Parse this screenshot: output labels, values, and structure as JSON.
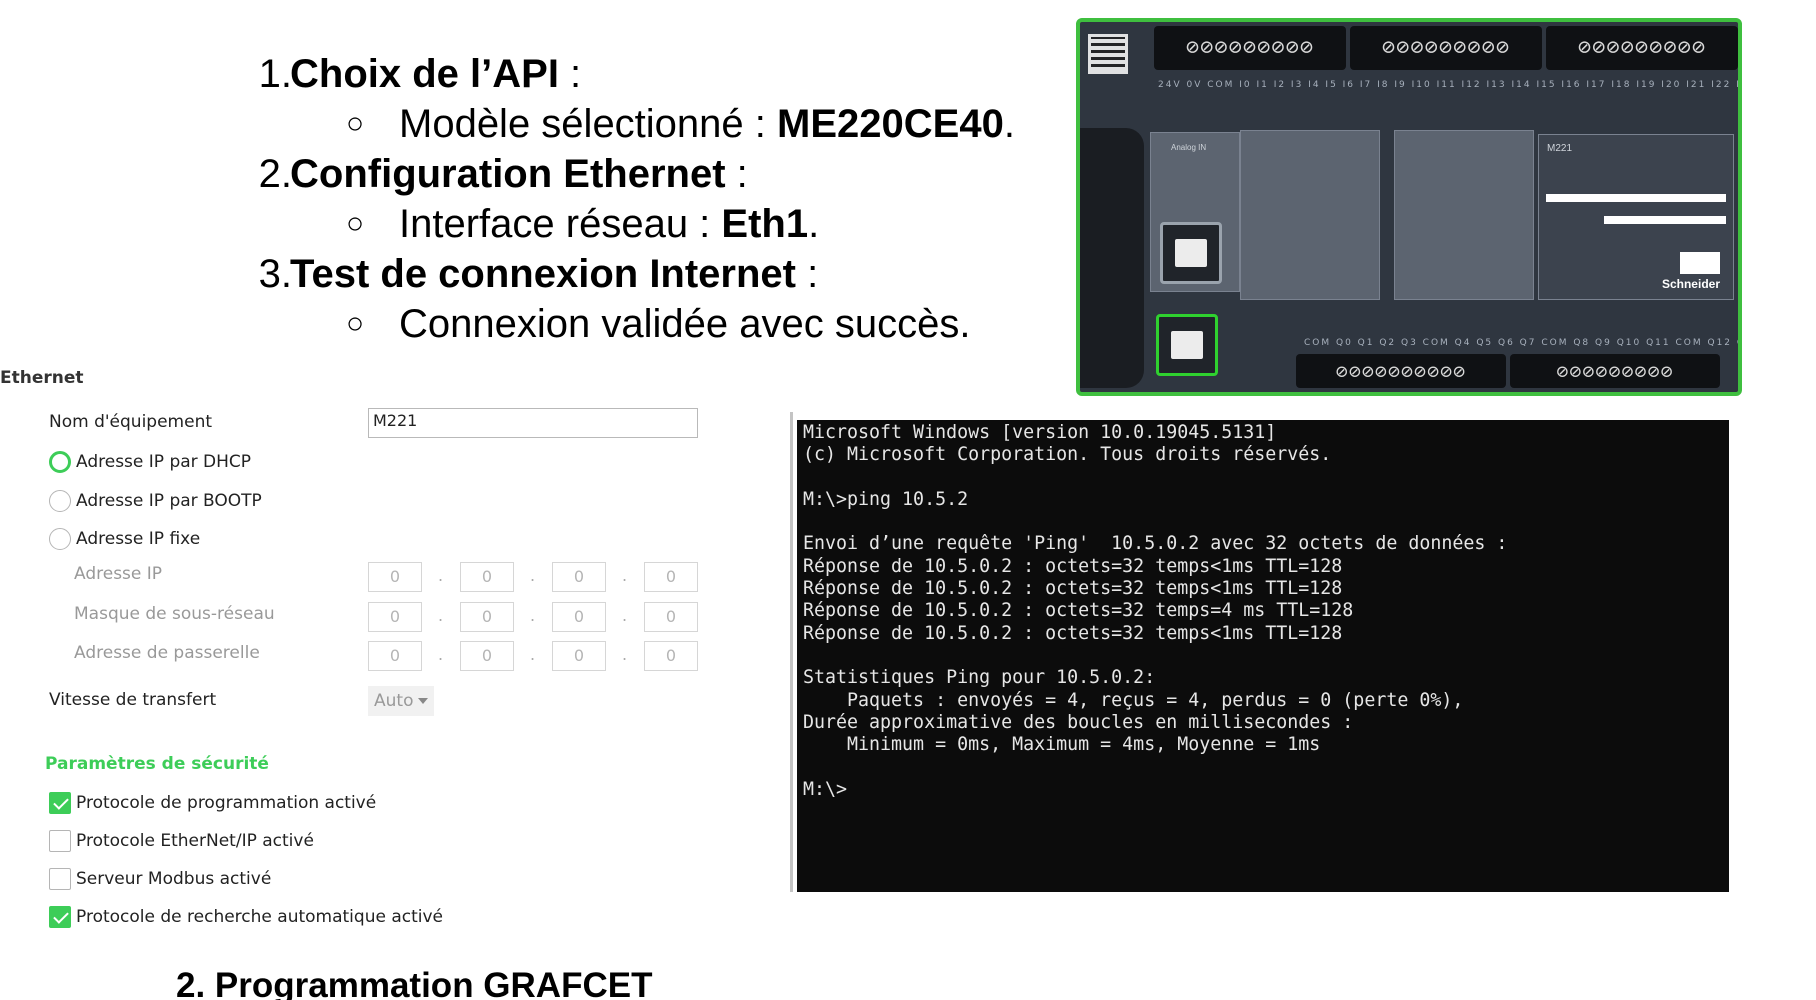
{
  "slide": {
    "items": [
      {
        "num": "1.",
        "bold": "Choix de l’API",
        "rest": " :"
      },
      {
        "bullet": "○",
        "text": "Modèle sélectionné : ",
        "bold": "ME220CE40",
        "rest": "."
      },
      {
        "num": "2.",
        "bold": "Configuration Ethernet",
        "rest": " :"
      },
      {
        "bullet": "○",
        "text": "Interface réseau : ",
        "bold": "Eth1",
        "rest": "."
      },
      {
        "num": "3.",
        "bold": "Test de connexion Internet",
        "rest": " :"
      },
      {
        "bullet": "○",
        "text": "Connexion validée avec succès.",
        "bold": "",
        "rest": ""
      }
    ],
    "footer": "2. Programmation GRAFCET"
  },
  "plc": {
    "terminals_top": [
      "⊘⊘⊘⊘⊘⊘⊘⊘⊘",
      "⊘⊘⊘⊘⊘⊘⊘⊘⊘",
      "⊘⊘⊘⊘⊘⊘⊘⊘⊘"
    ],
    "terminals_bottom": [
      "⊘⊘⊘⊘⊘⊘⊘⊘⊘⊘",
      "⊘⊘⊘⊘⊘⊘⊘⊘⊘"
    ],
    "model": "M221",
    "analog_label": "Analog IN",
    "brand": "Schneider"
  },
  "ethernet": {
    "section_title": "Ethernet",
    "device_name_label": "Nom d'équipement",
    "device_name_value": "M221",
    "dhcp_label": "Adresse IP par DHCP",
    "bootp_label": "Adresse IP par BOOTP",
    "fixed_label": "Adresse IP fixe",
    "ip_label": "Adresse IP",
    "mask_label": "Masque de sous-réseau",
    "gateway_label": "Adresse de passerelle",
    "octet": "0",
    "speed_label": "Vitesse de transfert",
    "speed_value": "Auto",
    "security_title": "Paramètres de sécurité",
    "check_programming": "Protocole de programmation activé",
    "check_ethernetip": "Protocole EtherNet/IP activé",
    "check_modbus": "Serveur Modbus activé",
    "check_discovery": "Protocole de recherche automatique activé"
  },
  "console": {
    "lines": [
      "Microsoft Windows [version 10.0.19045.5131]",
      "(c) Microsoft Corporation. Tous droits réservés.",
      "",
      "M:\\>ping 10.5.2",
      "",
      "Envoi d’une requête 'Ping'  10.5.0.2 avec 32 octets de données :",
      "Réponse de 10.5.0.2 : octets=32 temps<1ms TTL=128",
      "Réponse de 10.5.0.2 : octets=32 temps<1ms TTL=128",
      "Réponse de 10.5.0.2 : octets=32 temps=4 ms TTL=128",
      "Réponse de 10.5.0.2 : octets=32 temps<1ms TTL=128",
      "",
      "Statistiques Ping pour 10.5.0.2:",
      "    Paquets : envoyés = 4, reçus = 4, perdus = 0 (perte 0%),",
      "Durée approximative des boucles en millisecondes :",
      "    Minimum = 0ms, Maximum = 4ms, Moyenne = 1ms",
      "",
      "M:\\>"
    ]
  }
}
